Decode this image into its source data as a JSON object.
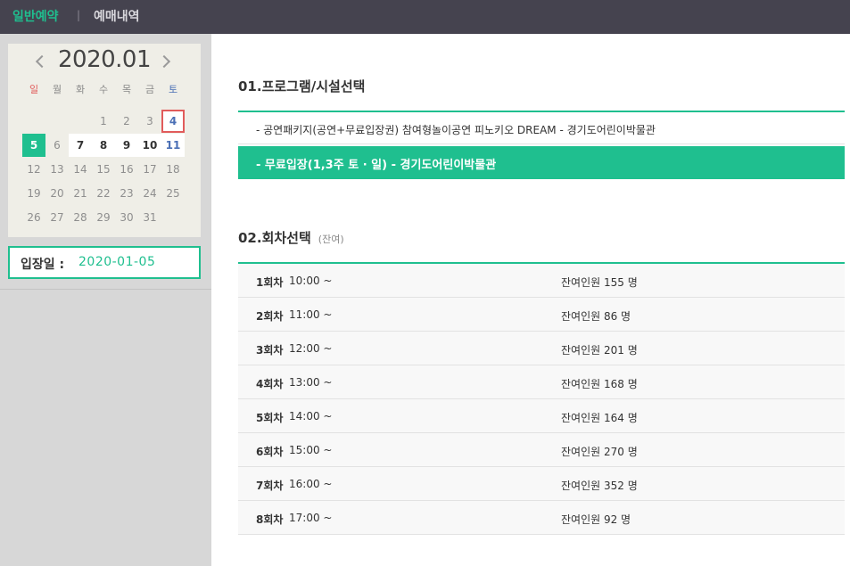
{
  "tabs": {
    "reservation": "일반예약",
    "separator": "|",
    "history": "예매내역"
  },
  "calendar": {
    "title": "2020.01",
    "weekdays": [
      "일",
      "월",
      "화",
      "수",
      "목",
      "금",
      "토"
    ],
    "weekday_colors": [
      "#e05a5a",
      "#888888",
      "#888888",
      "#888888",
      "#888888",
      "#888888",
      "#4a6fb5"
    ],
    "weeks": [
      [
        null,
        null,
        null,
        {
          "d": "1",
          "s": "off"
        },
        {
          "d": "2",
          "s": "off"
        },
        {
          "d": "3",
          "s": "off"
        },
        {
          "d": "4",
          "s": "today"
        }
      ],
      [
        {
          "d": "5",
          "s": "selected"
        },
        {
          "d": "6",
          "s": "off"
        },
        {
          "d": "7",
          "s": "avail"
        },
        {
          "d": "8",
          "s": "avail"
        },
        {
          "d": "9",
          "s": "avail"
        },
        {
          "d": "10",
          "s": "avail"
        },
        {
          "d": "11",
          "s": "sat-avail"
        }
      ],
      [
        {
          "d": "12",
          "s": "off"
        },
        {
          "d": "13",
          "s": "off"
        },
        {
          "d": "14",
          "s": "off"
        },
        {
          "d": "15",
          "s": "off"
        },
        {
          "d": "16",
          "s": "off"
        },
        {
          "d": "17",
          "s": "off"
        },
        {
          "d": "18",
          "s": "off"
        }
      ],
      [
        {
          "d": "19",
          "s": "off"
        },
        {
          "d": "20",
          "s": "off"
        },
        {
          "d": "21",
          "s": "off"
        },
        {
          "d": "22",
          "s": "off"
        },
        {
          "d": "23",
          "s": "off"
        },
        {
          "d": "24",
          "s": "off"
        },
        {
          "d": "25",
          "s": "off"
        }
      ],
      [
        {
          "d": "26",
          "s": "off"
        },
        {
          "d": "27",
          "s": "off"
        },
        {
          "d": "28",
          "s": "off"
        },
        {
          "d": "29",
          "s": "off"
        },
        {
          "d": "30",
          "s": "off"
        },
        {
          "d": "31",
          "s": "off"
        },
        null
      ]
    ]
  },
  "entry": {
    "label": "입장일 :",
    "date": "2020-01-05"
  },
  "section1": {
    "title": "01.프로그램/시설선택"
  },
  "programs": [
    "- 공연패키지(공연+무료입장권) 참여형놀이공연 피노키오 DREAM - 경기도어린이박물관",
    "- 무료입장(1,3주 토 · 일) - 경기도어린이박물관"
  ],
  "section2": {
    "title": "02.회차선택",
    "sub": "(잔여)"
  },
  "sessions": [
    {
      "no": "1회차",
      "time": "10:00 ~",
      "remain": "잔여인원 155 명"
    },
    {
      "no": "2회차",
      "time": "11:00 ~",
      "remain": "잔여인원 86 명"
    },
    {
      "no": "3회차",
      "time": "12:00 ~",
      "remain": "잔여인원 201 명"
    },
    {
      "no": "4회차",
      "time": "13:00 ~",
      "remain": "잔여인원 168 명"
    },
    {
      "no": "5회차",
      "time": "14:00 ~",
      "remain": "잔여인원 164 명"
    },
    {
      "no": "6회차",
      "time": "15:00 ~",
      "remain": "잔여인원 270 명"
    },
    {
      "no": "7회차",
      "time": "16:00 ~",
      "remain": "잔여인원 352 명"
    },
    {
      "no": "8회차",
      "time": "17:00 ~",
      "remain": "잔여인원 92 명"
    }
  ],
  "colors": {
    "accent": "#1fbf8f",
    "topbar": "#45434f",
    "today_border": "#e15b5b",
    "saturday": "#4a6fb5",
    "sunday": "#e05a5a"
  }
}
